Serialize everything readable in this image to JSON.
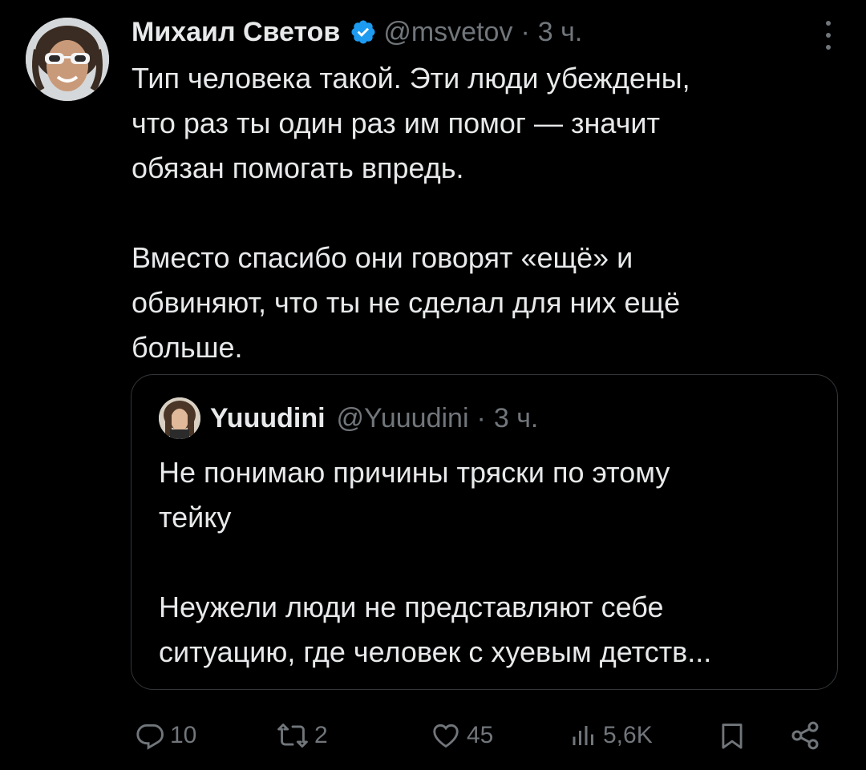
{
  "tweet": {
    "author_name": "Михаил Светов",
    "handle": "@msvetov",
    "separator": "·",
    "time": "3 ч.",
    "text": "Тип человека такой. Эти люди убеждены,\nчто раз ты один раз им помог — значит\nобязан помогать впредь.\n\nВместо спасибо они говорят «ещё» и\nобвиняют, что ты не сделал для них ещё\nбольше."
  },
  "quoted": {
    "author_name": "Yuuudini",
    "handle": "@Yuuudini",
    "separator": "·",
    "time": "3 ч.",
    "text": "Не понимаю причины тряски по этому\nтейку\n\nНеужели люди не представляют себе\nситуацию, где человек с хуевым детств..."
  },
  "actions": {
    "replies": "10",
    "reposts": "2",
    "likes": "45",
    "views": "5,6K"
  },
  "colors": {
    "background": "#000000",
    "text": "#e7e9ea",
    "muted": "#71767b",
    "border": "#333639",
    "verified": "#1d9bf0"
  },
  "icons": [
    "verified-badge-icon",
    "more-icon",
    "reply-icon",
    "repost-icon",
    "like-icon",
    "views-icon",
    "bookmark-icon",
    "share-icon"
  ]
}
